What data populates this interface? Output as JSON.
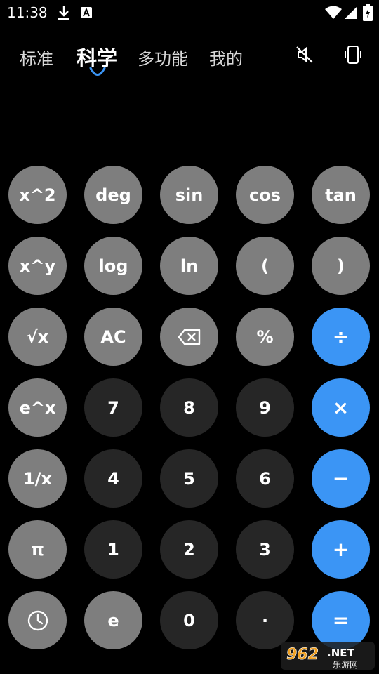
{
  "status_bar": {
    "time": "11:38",
    "icons": [
      "download-icon",
      "a-notification-icon",
      "wifi-icon",
      "signal-icon",
      "battery-icon"
    ]
  },
  "tabs": [
    {
      "label": "标准",
      "active": false
    },
    {
      "label": "科学",
      "active": true
    },
    {
      "label": "多功能",
      "active": false
    },
    {
      "label": "我的",
      "active": false
    }
  ],
  "header_icons": [
    "sound-off-icon",
    "vibrate-icon"
  ],
  "display": {
    "expression": "",
    "result": ""
  },
  "keypad": {
    "rows": [
      [
        "x^2",
        "deg",
        "sin",
        "cos",
        "tan"
      ],
      [
        "x^y",
        "log",
        "ln",
        "(",
        ")"
      ],
      [
        "√x",
        "AC",
        "",
        "%",
        "÷"
      ],
      [
        "e^x",
        "7",
        "8",
        "9",
        "×"
      ],
      [
        "1/x",
        "4",
        "5",
        "6",
        "−"
      ],
      [
        "π",
        "1",
        "2",
        "3",
        "+"
      ],
      [
        "",
        "e",
        "0",
        "·",
        "="
      ]
    ]
  },
  "colors": {
    "background": "#000000",
    "function_key": "#7e7e7e",
    "number_key": "#262626",
    "operator_key": "#3b95f5",
    "active_tab_indicator": "#3b95f5"
  },
  "watermark": {
    "main": "962.NET",
    "sub": "乐游网"
  }
}
